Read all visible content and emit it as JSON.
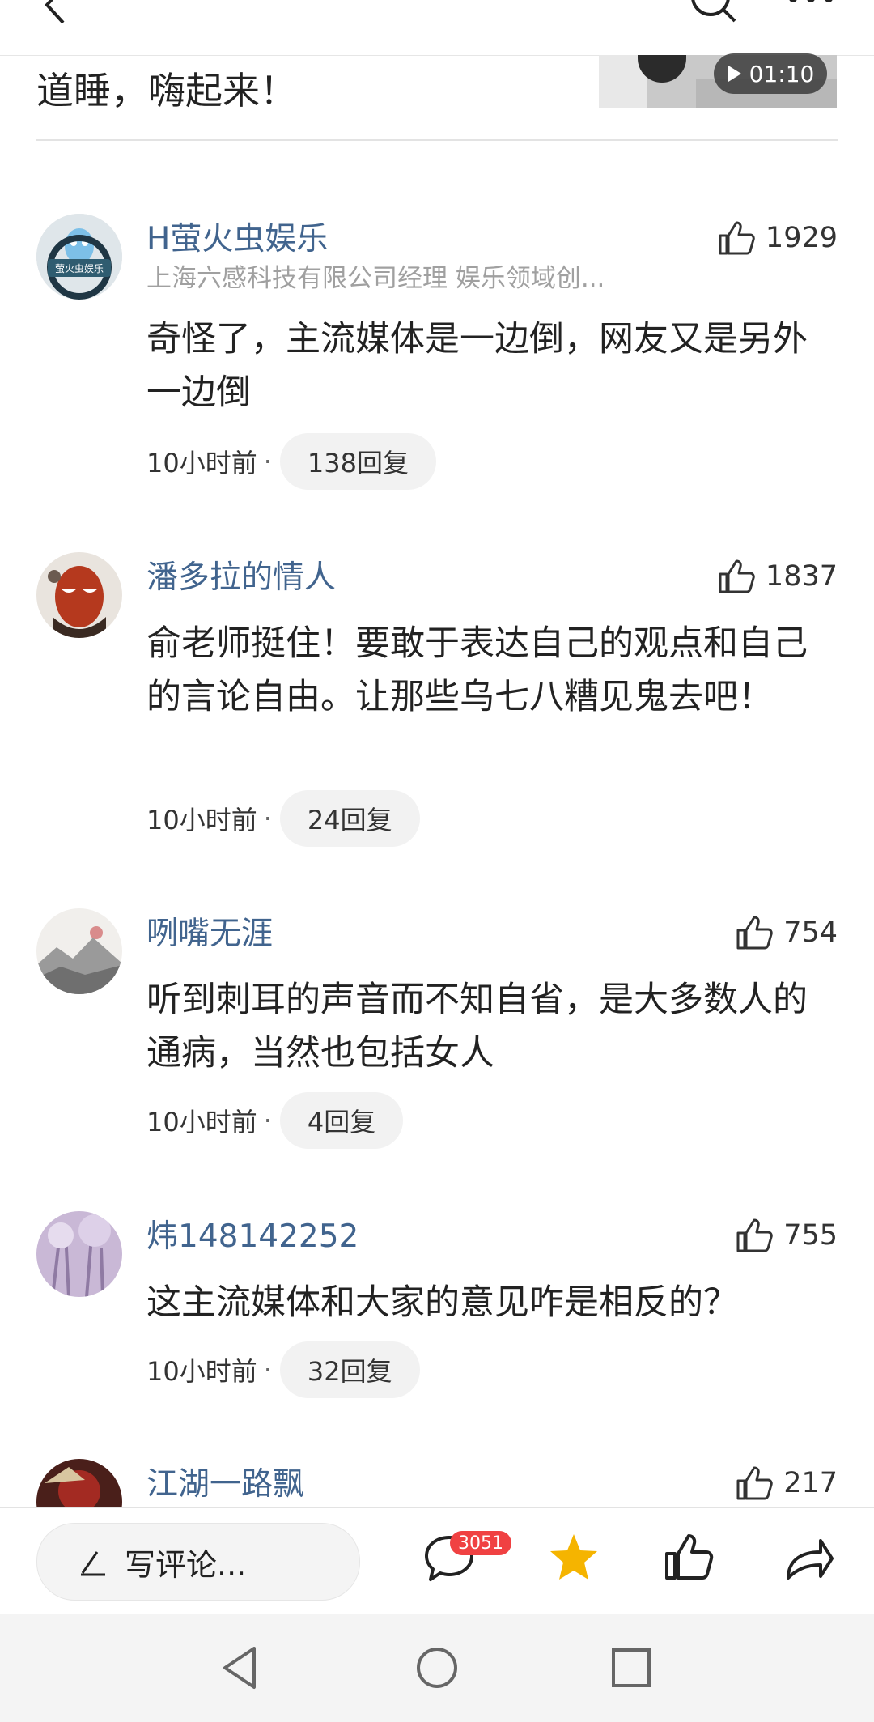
{
  "article": {
    "tail_text": "道睡，嗨起来！",
    "video_duration": "01:10"
  },
  "comments": [
    {
      "username": "H萤火虫娱乐",
      "subtitle": "上海六感科技有限公司经理 娱乐领域创...",
      "likes": "1929",
      "text": "奇怪了，主流媒体是一边倒，网友又是另外一边倒",
      "time": "10小时前",
      "replies": "138回复",
      "avatar_text": "萤火虫娱乐"
    },
    {
      "username": "潘多拉的情人",
      "likes": "1837",
      "text": "俞老师挺住！要敢于表达自己的观点和自己的言论自由。让那些乌七八糟见鬼去吧！",
      "time": "10小时前",
      "replies": "24回复"
    },
    {
      "username": "咧嘴无涯",
      "likes": "754",
      "text": "听到刺耳的声音而不知自省，是大多数人的通病，当然也包括女人",
      "time": "10小时前",
      "replies": "4回复"
    },
    {
      "username": "炜148142252",
      "likes": "755",
      "text": "这主流媒体和大家的意见咋是相反的？",
      "time": "10小时前",
      "replies": "32回复"
    },
    {
      "username": "江湖一路飘",
      "likes": "217"
    }
  ],
  "bottom_bar": {
    "input_placeholder": "写评论...",
    "comment_count": "3051"
  },
  "colors": {
    "username": "#41648e",
    "star": "#f5b400",
    "badge": "#f04142"
  },
  "icons": [
    "back-icon",
    "search-icon",
    "more-icon",
    "play-icon",
    "thumbs-up-icon",
    "pen-icon",
    "comment-icon",
    "star-icon",
    "share-icon",
    "nav-back-icon",
    "nav-home-icon",
    "nav-recents-icon"
  ]
}
